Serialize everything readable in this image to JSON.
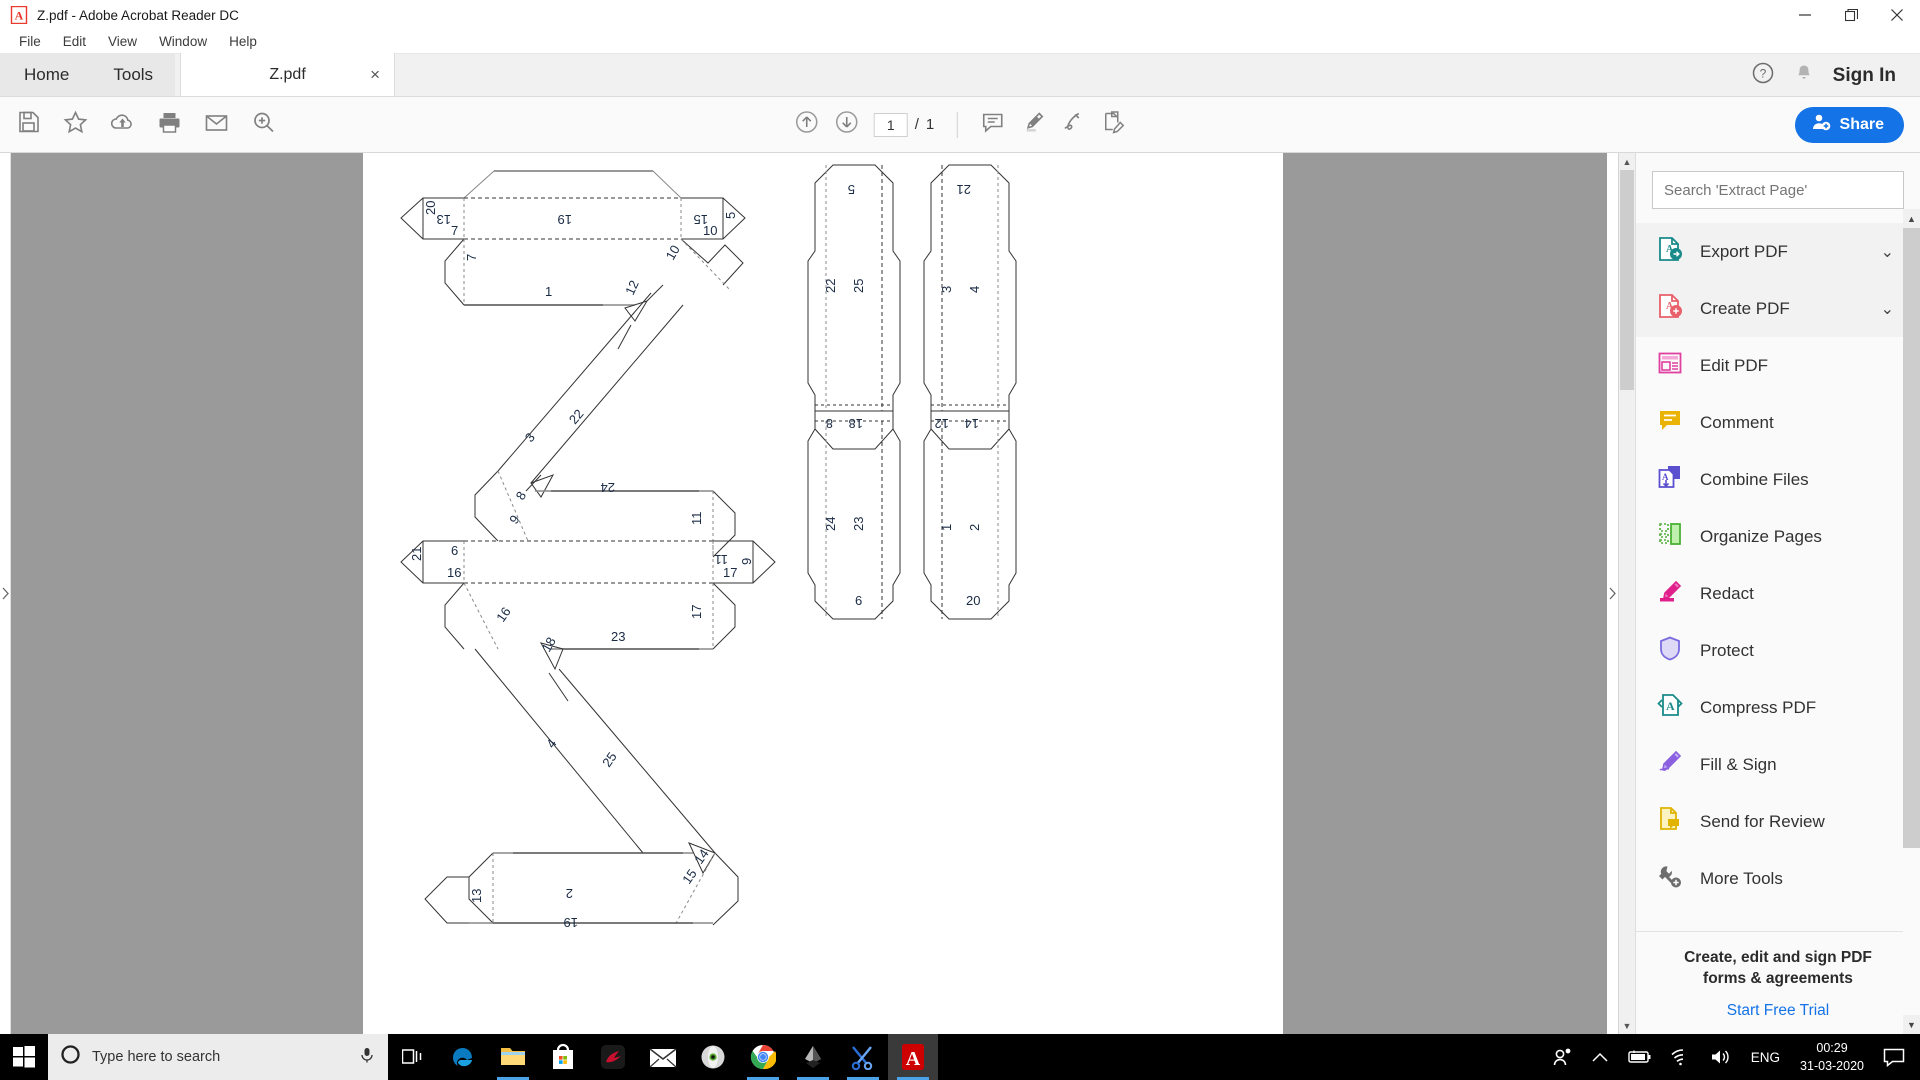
{
  "window": {
    "title": "Z.pdf - Adobe Acrobat Reader DC",
    "app_icon": "acrobat-icon",
    "minimize": "—",
    "maximize": "❐",
    "close": "✕"
  },
  "menubar": {
    "items": [
      {
        "label": "File"
      },
      {
        "label": "Edit"
      },
      {
        "label": "View"
      },
      {
        "label": "Window"
      },
      {
        "label": "Help"
      }
    ]
  },
  "tabstrip": {
    "home": "Home",
    "tools": "Tools",
    "document_tab": "Z.pdf",
    "tab_close": "×",
    "help_icon": "question-circle-icon",
    "bell_icon": "notification-bell-icon",
    "sign_in": "Sign In"
  },
  "toolbar": {
    "left_icons": [
      {
        "name": "save-icon",
        "label": "Save"
      },
      {
        "name": "star-icon",
        "label": "Add to favourites"
      },
      {
        "name": "cloud-upload-icon",
        "label": "Save to cloud"
      },
      {
        "name": "print-icon",
        "label": "Print"
      },
      {
        "name": "email-icon",
        "label": "Email"
      },
      {
        "name": "zoom-search-icon",
        "label": "Find"
      }
    ],
    "page_up": "↑",
    "page_down": "↓",
    "page_current": "1",
    "page_sep": "/",
    "page_total": "1",
    "right_icons": [
      {
        "name": "comment-icon",
        "label": "Comment"
      },
      {
        "name": "highlight-icon",
        "label": "Highlight text"
      },
      {
        "name": "sign-icon",
        "label": "Sign"
      },
      {
        "name": "fill-sign-icon",
        "label": "Fill and sign"
      }
    ],
    "share_label": "Share",
    "share_color": "#1473e6"
  },
  "right_panel": {
    "search_placeholder": "Search 'Extract Page'",
    "tools": [
      {
        "label": "Export PDF",
        "icon": "export-pdf-icon",
        "chevron": "⌄",
        "highlight": true,
        "color": "#1a8a8a"
      },
      {
        "label": "Create PDF",
        "icon": "create-pdf-icon",
        "chevron": "⌄",
        "highlight": true,
        "color": "#e8606a"
      },
      {
        "label": "Edit PDF",
        "icon": "edit-pdf-icon",
        "chevron": "",
        "highlight": false,
        "color": "#e040a0"
      },
      {
        "label": "Comment",
        "icon": "comment-tool-icon",
        "chevron": "",
        "highlight": false,
        "color": "#e8b500"
      },
      {
        "label": "Combine Files",
        "icon": "combine-files-icon",
        "chevron": "",
        "highlight": false,
        "color": "#5a4fcf"
      },
      {
        "label": "Organize Pages",
        "icon": "organize-pages-icon",
        "chevron": "",
        "highlight": false,
        "color": "#5fc24a"
      },
      {
        "label": "Redact",
        "icon": "redact-icon",
        "chevron": "",
        "highlight": false,
        "color": "#e0208a"
      },
      {
        "label": "Protect",
        "icon": "protect-shield-icon",
        "chevron": "",
        "highlight": false,
        "color": "#8a7ae0"
      },
      {
        "label": "Compress PDF",
        "icon": "compress-pdf-icon",
        "chevron": "",
        "highlight": false,
        "color": "#1a8a8a"
      },
      {
        "label": "Fill & Sign",
        "icon": "fill-sign-tool-icon",
        "chevron": "",
        "highlight": false,
        "color": "#9a5fe0"
      },
      {
        "label": "Send for Review",
        "icon": "send-review-icon",
        "chevron": "",
        "highlight": false,
        "color": "#e8c020"
      },
      {
        "label": "More Tools",
        "icon": "more-tools-wrench-icon",
        "chevron": "",
        "highlight": false,
        "color": "#6d6d6d"
      }
    ],
    "promo_line1": "Create, edit and sign PDF",
    "promo_line2": "forms & agreements",
    "promo_link": "Start Free Trial"
  },
  "document": {
    "title": "Z.pdf",
    "description": "Papercraft unfold net of the letter Z with numbered glue-tab edges",
    "net_labels": [
      "13",
      "20",
      "7",
      "19",
      "15",
      "5",
      "10",
      "7",
      "1",
      "10",
      "12",
      "3",
      "22",
      "8",
      "9",
      "24",
      "11",
      "21",
      "6",
      "16",
      "11",
      "17",
      "9",
      "16",
      "18",
      "23",
      "17",
      "4",
      "25",
      "14",
      "2",
      "13",
      "19",
      "15",
      "5",
      "22",
      "25",
      "8",
      "18",
      "24",
      "23",
      "6",
      "21",
      "3",
      "4",
      "12",
      "14",
      "1",
      "2",
      "20"
    ]
  },
  "taskbar": {
    "start_icon": "windows-start-icon",
    "search_placeholder": "Type here to search",
    "cortana_icon": "cortana-circle-icon",
    "mic_icon": "microphone-icon",
    "taskview_icon": "task-view-icon",
    "apps": [
      {
        "name": "edge-icon",
        "label": "Microsoft Edge",
        "running": false,
        "active": false
      },
      {
        "name": "file-explorer-icon",
        "label": "File Explorer",
        "running": true,
        "active": false
      },
      {
        "name": "microsoft-store-icon",
        "label": "Microsoft Store",
        "running": false,
        "active": false
      },
      {
        "name": "msi-dragon-icon",
        "label": "MSI Dragon Center",
        "running": false,
        "active": false
      },
      {
        "name": "mail-icon",
        "label": "Mail",
        "running": false,
        "active": false
      },
      {
        "name": "opera-icon",
        "label": "Opera",
        "running": false,
        "active": false
      },
      {
        "name": "chrome-icon",
        "label": "Google Chrome",
        "running": true,
        "active": false
      },
      {
        "name": "inkscape-icon",
        "label": "Inkscape",
        "running": true,
        "active": false
      },
      {
        "name": "snipping-tool-icon",
        "label": "Snipping Tool",
        "running": true,
        "active": false
      },
      {
        "name": "acrobat-reader-icon",
        "label": "Adobe Acrobat Reader DC",
        "running": true,
        "active": true
      }
    ],
    "tray": {
      "people_icon": "people-icon",
      "chevron_icon": "show-hidden-icons-chevron",
      "battery_icon": "battery-charging-icon",
      "wifi_icon": "wifi-icon",
      "volume_icon": "volume-icon",
      "language": "ENG",
      "time": "00:29",
      "date": "31-03-2020",
      "action_center_icon": "action-center-icon"
    }
  }
}
